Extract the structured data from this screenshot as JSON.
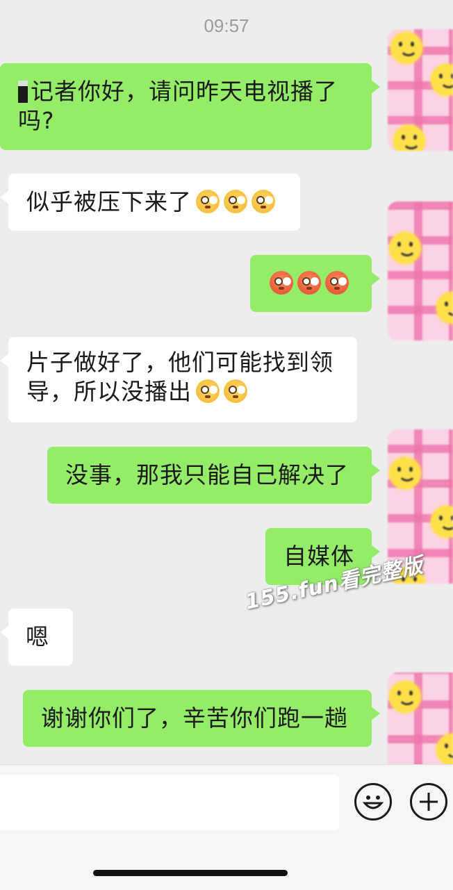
{
  "status_time": "09:57",
  "messages": [
    {
      "side": "out",
      "text": "记者你好，请问昨天电视播了吗?"
    },
    {
      "side": "in",
      "text": "似乎被压下来了",
      "emoji": [
        "flushed-face",
        "flushed-face",
        "flushed-face"
      ]
    },
    {
      "side": "out",
      "text": "",
      "emoji": [
        "angry-face",
        "angry-face",
        "angry-face"
      ]
    },
    {
      "side": "in",
      "text_line1": "片子做好了，他们可能找到领",
      "text_line2": "导，所以没播出",
      "emoji": [
        "woozy-face",
        "woozy-face"
      ]
    },
    {
      "side": "out",
      "text": "没事，那我只能自己解决了"
    },
    {
      "side": "out",
      "text": "自媒体"
    },
    {
      "side": "in",
      "text": "嗯"
    },
    {
      "side": "out",
      "text": "谢谢你们了，辛苦你们跑一趟"
    }
  ],
  "watermark": "155.fun看完整版",
  "input": {
    "value": "",
    "placeholder": ""
  },
  "icons": {
    "emoji_button": "smiley-icon",
    "more_button": "plus-icon"
  },
  "colors": {
    "outgoing_bubble": "#95ec69",
    "incoming_bubble": "#ffffff",
    "background": "#ededed"
  }
}
